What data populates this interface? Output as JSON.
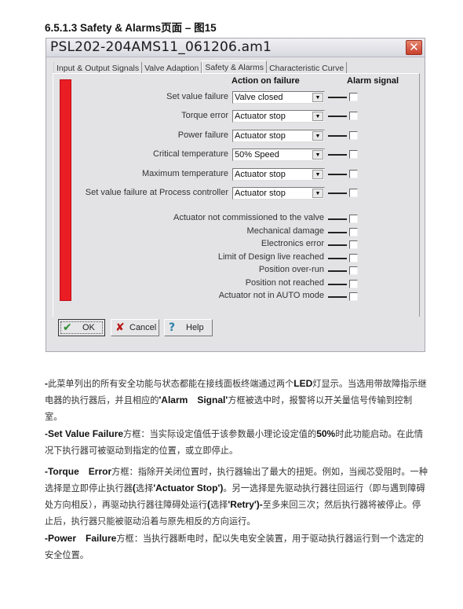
{
  "section_title": "6.5.1.3 Safety & Alarms页面 – 图15",
  "window": {
    "title": "PSL202-204AMS11_061206.am1",
    "close_glyph": "✕",
    "tabs": [
      {
        "label": "Input & Output Signals",
        "active": false
      },
      {
        "label": "Valve Adaption",
        "active": false
      },
      {
        "label": "Safety & Alarms",
        "active": true
      },
      {
        "label": "Characteristic Curve",
        "active": false
      }
    ],
    "headers": {
      "action": "Action on failure",
      "alarm": "Alarm signal"
    },
    "status_color": "#ea1c24",
    "failure_rows": [
      {
        "label": "Set value failure",
        "value": "Valve closed",
        "alarm_checked": false
      },
      {
        "label": "Torque error",
        "value": "Actuator stop",
        "alarm_checked": false
      },
      {
        "label": "Power failure",
        "value": "Actuator stop",
        "alarm_checked": false
      },
      {
        "label": "Critical temperature",
        "value": "50% Speed",
        "alarm_checked": false
      },
      {
        "label": "Maximum temperature",
        "value": "Actuator stop",
        "alarm_checked": false
      },
      {
        "label": "Set value failure at Process controller",
        "value": "Actuator stop",
        "alarm_checked": false
      }
    ],
    "alarm_rows": [
      {
        "label": "Actuator not commissioned to the valve",
        "checked": false
      },
      {
        "label": "Mechanical damage",
        "checked": false
      },
      {
        "label": "Electronics error",
        "checked": false
      },
      {
        "label": "Limit of Design live reached",
        "checked": false
      },
      {
        "label": "Position over-run",
        "checked": false
      },
      {
        "label": "Position not reached",
        "checked": false
      },
      {
        "label": "Actuator not in AUTO mode",
        "checked": false
      }
    ],
    "dropdown_arrow": "▼",
    "buttons": {
      "ok": {
        "label": "OK",
        "icon": "✔"
      },
      "cancel": {
        "label": "Cancel",
        "icon": "✘"
      },
      "help": {
        "label": "Help",
        "icon": "?"
      }
    }
  },
  "paragraphs": [
    {
      "parts": [
        {
          "b": "-"
        },
        {
          "t": "此菜单列出的所有安全功能与状态都能在接线面板终端通过两个"
        },
        {
          "b": "LED"
        },
        {
          "t": "灯显示。当选用带故障指示继电器的执行器后，并且相应的"
        },
        {
          "b": "'Alarm　Signal'"
        },
        {
          "t": "方框被选中时，报警将以开关量信号传输到控制室。"
        }
      ]
    },
    {
      "parts": [
        {
          "b": "-Set Value Failure"
        },
        {
          "t": "方框：当实际设定值低于该参数最小理论设定值的"
        },
        {
          "b": "50%"
        },
        {
          "t": "时此功能启动。在此情况下执行器可被驱动到指定的位置，或立即停止。"
        }
      ]
    },
    {
      "parts": [
        {
          "b": "-Torque　Error"
        },
        {
          "t": "方框：指除开关闭位置时，执行器输出了最大的扭矩。例如，当阀芯受阻时。一种选择是立即停止执行器"
        },
        {
          "b": "("
        },
        {
          "t": "选择"
        },
        {
          "b": "'Actuator Stop')"
        },
        {
          "t": "。另一选择是先驱动执行器往回运行（即与遇到障碍处方向相反），再驱动执行器往障碍处运行"
        },
        {
          "b": "("
        },
        {
          "t": "选择"
        },
        {
          "b": "'Retry')-"
        },
        {
          "t": "至多来回三次；然后执行器将被停止。停止后，执行器只能被驱动沿着与原先相反的方向运行。"
        }
      ]
    },
    {
      "parts": [
        {
          "b": "-Power　Failure"
        },
        {
          "t": "方框：当执行器断电时，配以失电安全装置，用于驱动执行器运行到一个选定的安全位置。"
        }
      ]
    }
  ]
}
